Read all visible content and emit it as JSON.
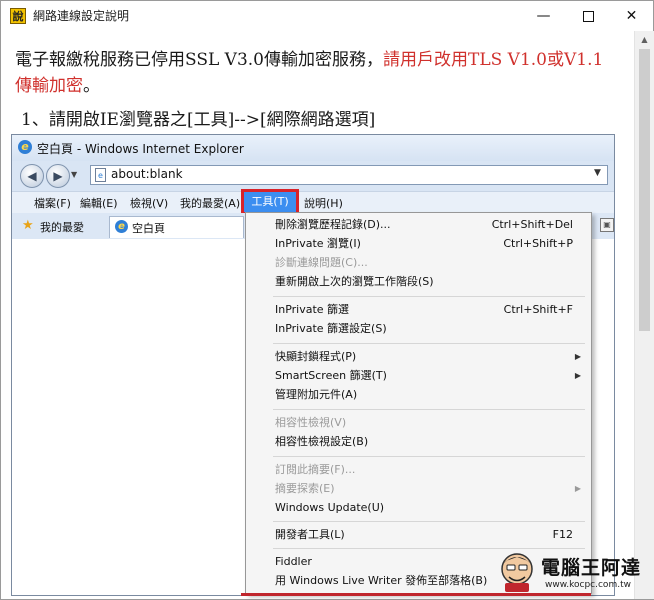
{
  "window": {
    "title": "網路連線設定說明",
    "app_icon_glyph": "說",
    "minimize_glyph": "—",
    "close_glyph": "✕"
  },
  "article": {
    "paragraph_normal": "電子報繳稅服務已停用SSL V3.0傳輸加密服務，",
    "paragraph_red": "請用戶改用TLS V1.0或V1.1傳輸加密",
    "paragraph_end": "。",
    "step1": "1、請開啟IE瀏覽器之[工具]-->[網際網路選項]",
    "red_color": "#d0312d"
  },
  "ie": {
    "window_title": "空白頁 - Windows Internet Explorer",
    "address": "about:blank",
    "menus": {
      "file": "檔案(F)",
      "edit": "編輯(E)",
      "view": "檢視(V)",
      "favorites": "我的最愛(A)",
      "tools": "工具(T)",
      "help": "說明(H)"
    },
    "favorites_bar_label": "我的最愛",
    "tab_label": "空白頁",
    "tools_highlight_color": "#3c8ef0",
    "highlight_border_color": "#d8232a"
  },
  "tools_menu": {
    "items": [
      {
        "label": "刪除瀏覽歷程記錄(D)...",
        "shortcut": "Ctrl+Shift+Del",
        "disabled": false,
        "submenu": false
      },
      {
        "label": "InPrivate 瀏覽(I)",
        "shortcut": "Ctrl+Shift+P",
        "disabled": false,
        "submenu": false
      },
      {
        "label": "診斷連線問題(C)...",
        "shortcut": "",
        "disabled": true,
        "submenu": false
      },
      {
        "label": "重新開啟上次的瀏覽工作階段(S)",
        "shortcut": "",
        "disabled": false,
        "submenu": false
      },
      {
        "label": "InPrivate 篩選",
        "shortcut": "Ctrl+Shift+F",
        "disabled": false,
        "submenu": false
      },
      {
        "label": "InPrivate 篩選設定(S)",
        "shortcut": "",
        "disabled": false,
        "submenu": false
      },
      {
        "label": "快顯封鎖程式(P)",
        "shortcut": "",
        "disabled": false,
        "submenu": true
      },
      {
        "label": "SmartScreen 篩選(T)",
        "shortcut": "",
        "disabled": false,
        "submenu": true
      },
      {
        "label": "管理附加元件(A)",
        "shortcut": "",
        "disabled": false,
        "submenu": false
      },
      {
        "label": "相容性檢視(V)",
        "shortcut": "",
        "disabled": true,
        "submenu": false
      },
      {
        "label": "相容性檢視設定(B)",
        "shortcut": "",
        "disabled": false,
        "submenu": false
      },
      {
        "label": "訂閱此摘要(F)...",
        "shortcut": "",
        "disabled": true,
        "submenu": false
      },
      {
        "label": "摘要探索(E)",
        "shortcut": "",
        "disabled": true,
        "submenu": true
      },
      {
        "label": "Windows Update(U)",
        "shortcut": "",
        "disabled": false,
        "submenu": false
      },
      {
        "label": "開發者工具(L)",
        "shortcut": "F12",
        "disabled": false,
        "submenu": false
      },
      {
        "label": "Fiddler",
        "shortcut": "",
        "disabled": false,
        "submenu": false
      },
      {
        "label": "用 Windows Live Writer 發佈至部落格(B)",
        "shortcut": "",
        "disabled": false,
        "submenu": false
      }
    ]
  },
  "watermark": {
    "brand": "電腦王阿達",
    "url": "www.kocpc.com.tw"
  }
}
